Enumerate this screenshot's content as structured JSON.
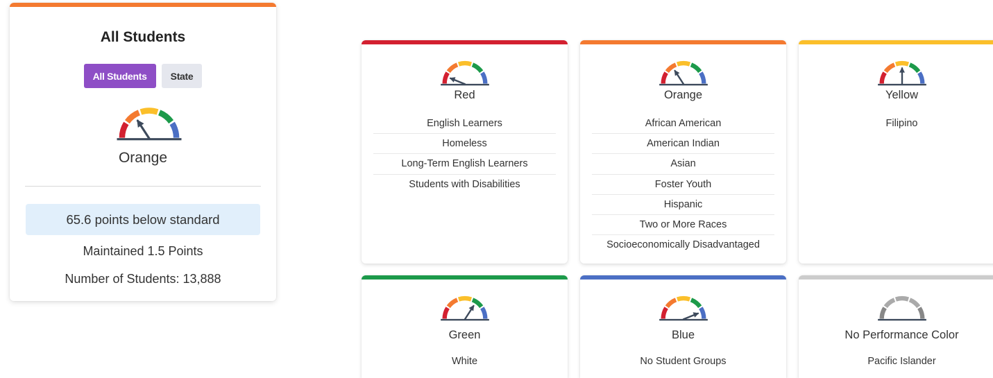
{
  "summary": {
    "title": "All Students",
    "toggle_all_students": "All Students",
    "toggle_state": "State",
    "color_label": "Orange",
    "status_text": "65.6 points below standard",
    "change_text": "Maintained 1.5 Points",
    "students_count_text": "Number of Students: 13,888",
    "gauge_level": 2
  },
  "colors": {
    "red": "#d32030",
    "orange": "#f47a30",
    "yellow": "#fbbf2a",
    "green": "#1c9a4a",
    "blue": "#4b6fc4",
    "gray": "#cccccc",
    "purple": "#8e4ec6"
  },
  "groups": {
    "red": {
      "title": "Red",
      "gauge_level": 1,
      "items": [
        "English Learners",
        "Homeless",
        "Long-Term English Learners",
        "Students with Disabilities"
      ]
    },
    "orange": {
      "title": "Orange",
      "gauge_level": 2,
      "items": [
        "African American",
        "American Indian",
        "Asian",
        "Foster Youth",
        "Hispanic",
        "Two or More Races",
        "Socioeconomically Disadvantaged"
      ]
    },
    "yellow": {
      "title": "Yellow",
      "gauge_level": 3,
      "items": [
        "Filipino"
      ]
    },
    "green": {
      "title": "Green",
      "gauge_level": 4,
      "items": [
        "White"
      ]
    },
    "blue": {
      "title": "Blue",
      "gauge_level": 5,
      "items": [
        "No Student Groups"
      ]
    },
    "none": {
      "title": "No Performance Color",
      "gauge_level": 0,
      "items": [
        "Pacific Islander"
      ]
    }
  }
}
